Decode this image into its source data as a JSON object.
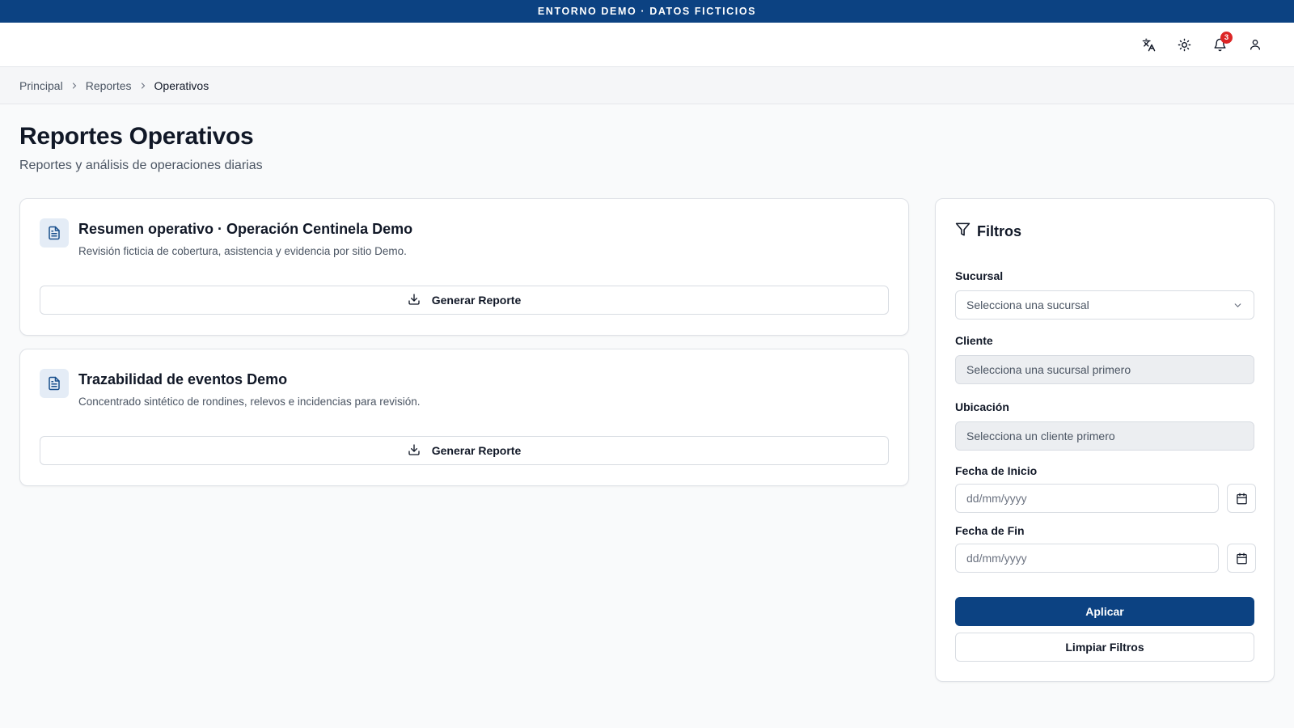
{
  "banner": {
    "text": "ENTORNO DEMO · DATOS FICTICIOS"
  },
  "topbar": {
    "icons": [
      "translate-icon",
      "sun-icon",
      "bell-icon",
      "user-icon"
    ],
    "notifications_count": "3"
  },
  "breadcrumb": {
    "items": [
      "Principal",
      "Reportes",
      "Operativos"
    ]
  },
  "page": {
    "title": "Reportes Operativos",
    "subtitle": "Reportes y análisis de operaciones diarias"
  },
  "reports": [
    {
      "title": "Resumen operativo · Operación Centinela Demo",
      "description": "Revisión ficticia de cobertura, asistencia y evidencia por sitio Demo.",
      "button_label": "Generar Reporte"
    },
    {
      "title": "Trazabilidad de eventos Demo",
      "description": "Concentrado sintético de rondines, relevos e incidencias para revisión.",
      "button_label": "Generar Reporte"
    }
  ],
  "filters": {
    "title": "Filtros",
    "branch": {
      "label": "Sucursal",
      "placeholder": "Selecciona una sucursal"
    },
    "client": {
      "label": "Cliente",
      "placeholder": "Selecciona una sucursal primero"
    },
    "location": {
      "label": "Ubicación",
      "placeholder": "Selecciona un cliente primero"
    },
    "start_date": {
      "label": "Fecha de Inicio",
      "placeholder": "dd/mm/yyyy"
    },
    "end_date": {
      "label": "Fecha de Fin",
      "placeholder": "dd/mm/yyyy"
    },
    "apply_label": "Aplicar",
    "clear_label": "Limpiar Filtros"
  },
  "colors": {
    "primary": "#0c4282",
    "badge": "#dc2626",
    "doc_icon_bg": "#e4ecf6"
  }
}
